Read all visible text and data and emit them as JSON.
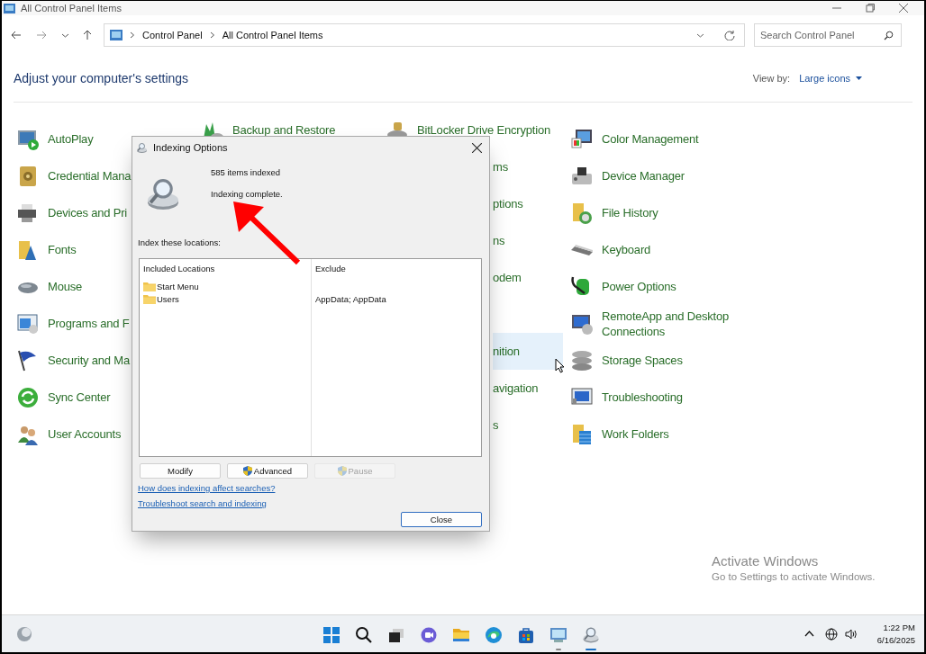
{
  "window": {
    "title": "All Control Panel Items"
  },
  "address_bar": {
    "breadcrumb": [
      "Control Panel",
      "All Control Panel Items"
    ]
  },
  "search": {
    "placeholder": "Search Control Panel"
  },
  "header": {
    "title": "Adjust your computer's settings",
    "view_by_label": "View by:",
    "view_by_value": "Large icons"
  },
  "columns": [
    [
      {
        "kind": "full",
        "label": "AutoPlay",
        "highlighted": false
      },
      {
        "kind": "full",
        "label": "Credential Mana",
        "highlighted": false
      },
      {
        "kind": "full",
        "label": "Devices and Pri",
        "highlighted": false
      },
      {
        "kind": "full",
        "label": "Fonts",
        "highlighted": false
      },
      {
        "kind": "full",
        "label": "Mouse",
        "highlighted": false
      },
      {
        "kind": "full",
        "label": "Programs and F",
        "highlighted": false
      },
      {
        "kind": "full",
        "label": "Security and Ma",
        "highlighted": false
      },
      {
        "kind": "full",
        "label": "Sync Center",
        "highlighted": false
      },
      {
        "kind": "full",
        "label": "User Accounts",
        "highlighted": false
      }
    ],
    [
      {
        "kind": "full",
        "label": "Backup and Restore",
        "highlighted": false
      }
    ],
    [
      {
        "kind": "full",
        "label": "BitLocker Drive Encryption",
        "highlighted": false
      },
      {
        "kind": "partial",
        "label": "ms",
        "highlighted": false
      },
      {
        "kind": "partial",
        "label": "ptions",
        "highlighted": false
      },
      {
        "kind": "partial",
        "label": "ns",
        "highlighted": false
      },
      {
        "kind": "partial",
        "label": "odem",
        "highlighted": false
      },
      {
        "kind": "hidden"
      },
      {
        "kind": "partial",
        "label": "nition",
        "highlighted": true
      },
      {
        "kind": "partial",
        "label": "avigation",
        "highlighted": false
      },
      {
        "kind": "partial",
        "label": "s",
        "highlighted": false
      }
    ],
    [
      {
        "kind": "full",
        "label": "Color Management",
        "highlighted": false
      },
      {
        "kind": "full",
        "label": "Device Manager",
        "highlighted": false
      },
      {
        "kind": "full",
        "label": "File History",
        "highlighted": false
      },
      {
        "kind": "full",
        "label": "Keyboard",
        "highlighted": false
      },
      {
        "kind": "full",
        "label": "Power Options",
        "highlighted": false
      },
      {
        "kind": "full",
        "label": "RemoteApp and Desktop Connections",
        "highlighted": false
      },
      {
        "kind": "full",
        "label": "Storage Spaces",
        "highlighted": false
      },
      {
        "kind": "full",
        "label": "Troubleshooting",
        "highlighted": false
      },
      {
        "kind": "full",
        "label": "Work Folders",
        "highlighted": false
      }
    ]
  ],
  "dialog": {
    "title": "Indexing Options",
    "items_indexed": "585 items indexed",
    "status": "Indexing complete.",
    "locations_label": "Index these locations:",
    "table": {
      "columns": [
        "Included Locations",
        "Exclude"
      ],
      "rows": [
        {
          "location": "Start Menu"
        },
        {
          "location": "Users",
          "exclude": "AppData; AppData"
        }
      ]
    },
    "buttons": [
      {
        "label": "Modify",
        "shield": false,
        "disabled": false
      },
      {
        "label": "Advanced",
        "shield": true,
        "disabled": false
      },
      {
        "label": "Pause",
        "shield": true,
        "disabled": true
      }
    ],
    "links": [
      "How does indexing affect searches?",
      "Troubleshoot search and indexing"
    ],
    "close_button": "Close"
  },
  "activation": {
    "title": "Activate Windows",
    "text": "Go to Settings to activate Windows."
  },
  "taskbar": {
    "apps": [
      {
        "kind": "start",
        "running": false,
        "focused": false
      },
      {
        "kind": "search",
        "running": false,
        "focused": false
      },
      {
        "kind": "taskview",
        "running": false,
        "focused": false
      },
      {
        "kind": "chat",
        "running": false,
        "focused": false
      },
      {
        "kind": "explorer",
        "running": false,
        "focused": false
      },
      {
        "kind": "browser",
        "running": false,
        "focused": false
      },
      {
        "kind": "store",
        "running": false,
        "focused": false
      },
      {
        "kind": "controlpanel",
        "running": true,
        "focused": false
      },
      {
        "kind": "indexing",
        "running": true,
        "focused": true
      }
    ],
    "clock": {
      "time": "1:22 PM",
      "date": "6/16/2025"
    }
  }
}
